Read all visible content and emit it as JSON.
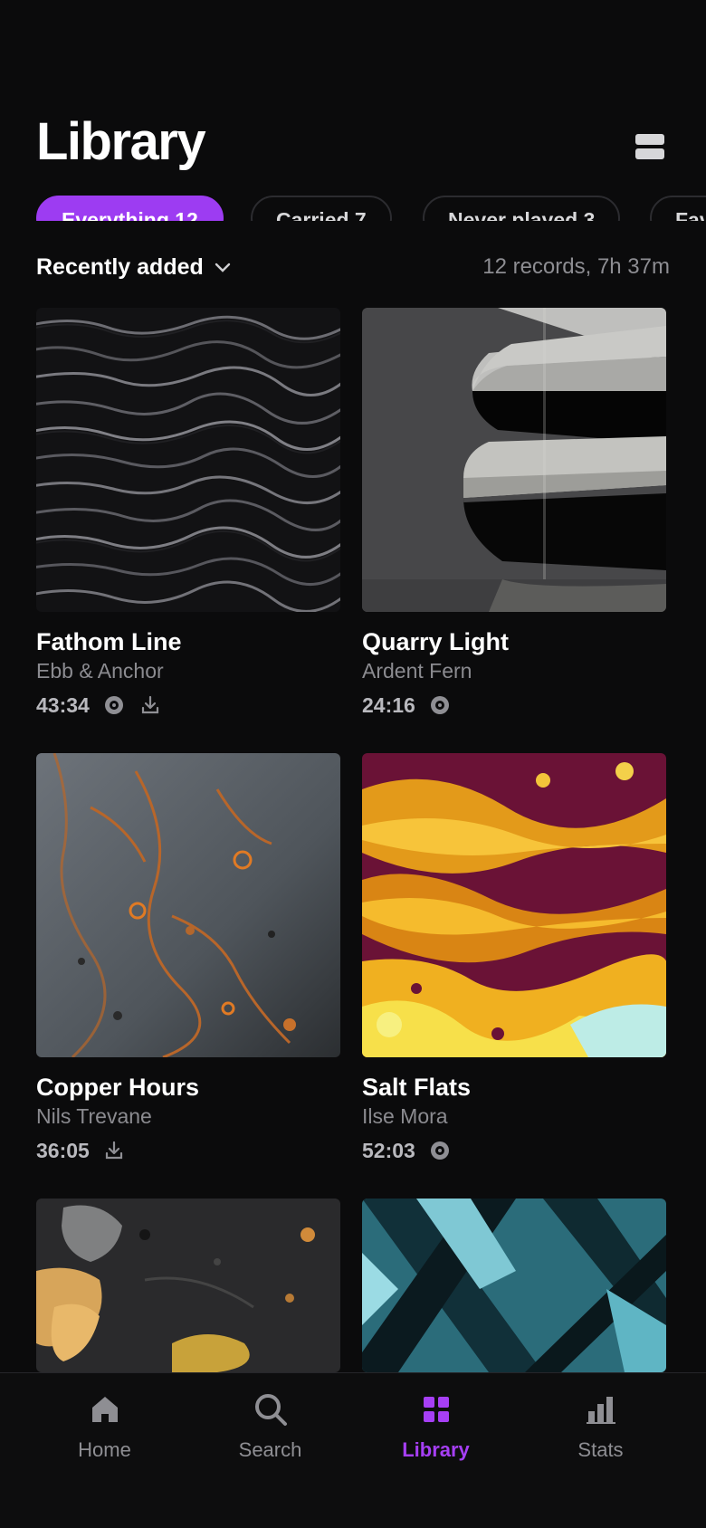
{
  "header": {
    "title": "Library"
  },
  "filters": [
    {
      "label": "Everything 12",
      "active": true
    },
    {
      "label": "Carried 7",
      "active": false
    },
    {
      "label": "Never played 3",
      "active": false
    },
    {
      "label": "Favourites",
      "active": false
    }
  ],
  "sort": {
    "label": "Recently added",
    "summary": "12 records, 7h 37m"
  },
  "records": [
    {
      "title": "Fathom Line",
      "artist": "Ebb & Anchor",
      "duration": "43:34",
      "icons": [
        "vinyl-icon",
        "download-icon"
      ]
    },
    {
      "title": "Quarry Light",
      "artist": "Ardent Fern",
      "duration": "24:16",
      "icons": [
        "vinyl-icon"
      ]
    },
    {
      "title": "Copper Hours",
      "artist": "Nils Trevane",
      "duration": "36:05",
      "icons": [
        "download-icon"
      ]
    },
    {
      "title": "Salt Flats",
      "artist": "Ilse Mora",
      "duration": "52:03",
      "icons": [
        "vinyl-icon"
      ]
    }
  ],
  "nav": {
    "home": "Home",
    "search": "Search",
    "library": "Library",
    "stats": "Stats",
    "active": "library"
  },
  "colors": {
    "accent": "#9d3cf2",
    "background": "#0b0b0c",
    "muted": "#8b8b90"
  }
}
